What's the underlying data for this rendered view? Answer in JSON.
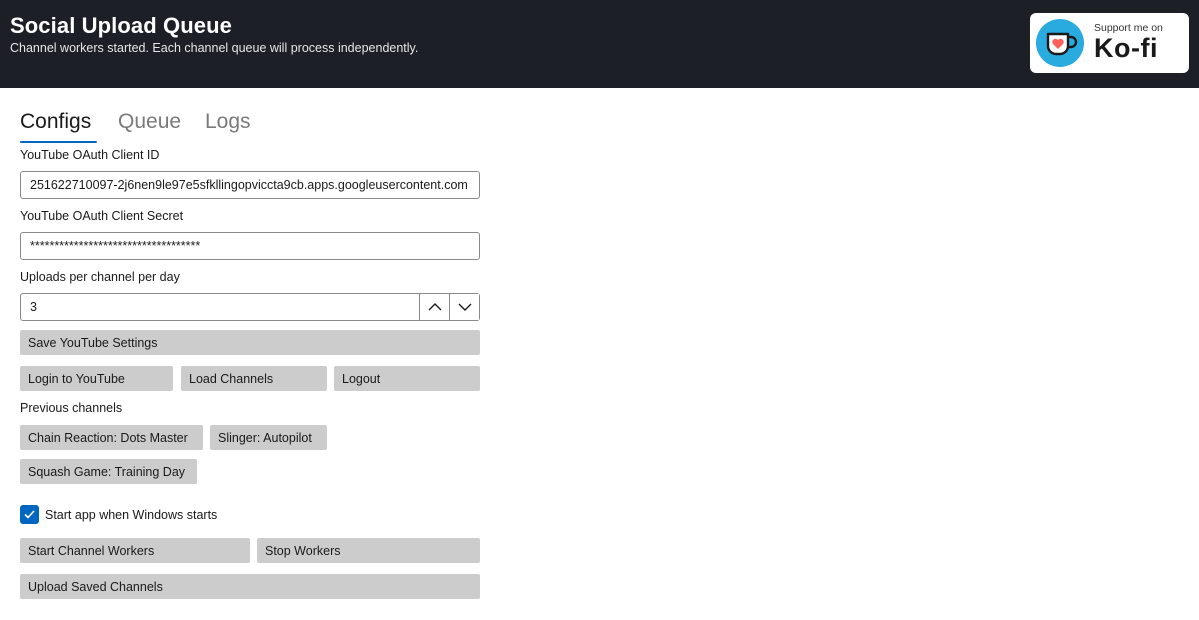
{
  "header": {
    "title": "Social Upload Queue",
    "subtitle": "Channel workers started. Each channel queue will process independently."
  },
  "kofi": {
    "small": "Support me on",
    "big": "Ko-fi",
    "icon": "kofi-cup-heart-icon"
  },
  "tabs": [
    {
      "label": "Configs",
      "active": true
    },
    {
      "label": "Queue",
      "active": false
    },
    {
      "label": "Logs",
      "active": false
    }
  ],
  "youtube": {
    "client_id_label": "YouTube OAuth Client ID",
    "client_id_value": "251622710097-2j6nen9le97e5sfkllingopviccta9cb.apps.googleusercontent.com",
    "client_secret_label": "YouTube OAuth Client Secret",
    "client_secret_value": "***********************************",
    "uploads_label": "Uploads per channel per day",
    "uploads_value": "3",
    "save_label": "Save YouTube Settings"
  },
  "auth_buttons": {
    "login": "Login to YouTube",
    "load": "Load Channels",
    "logout": "Logout"
  },
  "previous_channels": {
    "label": "Previous channels",
    "items": [
      "Chain Reaction: Dots Master",
      "Slinger: Autopilot",
      "Squash Game: Training Day"
    ]
  },
  "startup": {
    "label": "Start app when Windows starts",
    "checked": true
  },
  "workers": {
    "start": "Start Channel Workers",
    "stop": "Stop Workers",
    "upload_saved": "Upload Saved Channels"
  },
  "colors": {
    "header_bg": "#1c1f25",
    "accent": "#0067c0",
    "button_bg": "#cccccc",
    "kofi_blue": "#29abe0",
    "kofi_heart": "#ff5e5b"
  }
}
